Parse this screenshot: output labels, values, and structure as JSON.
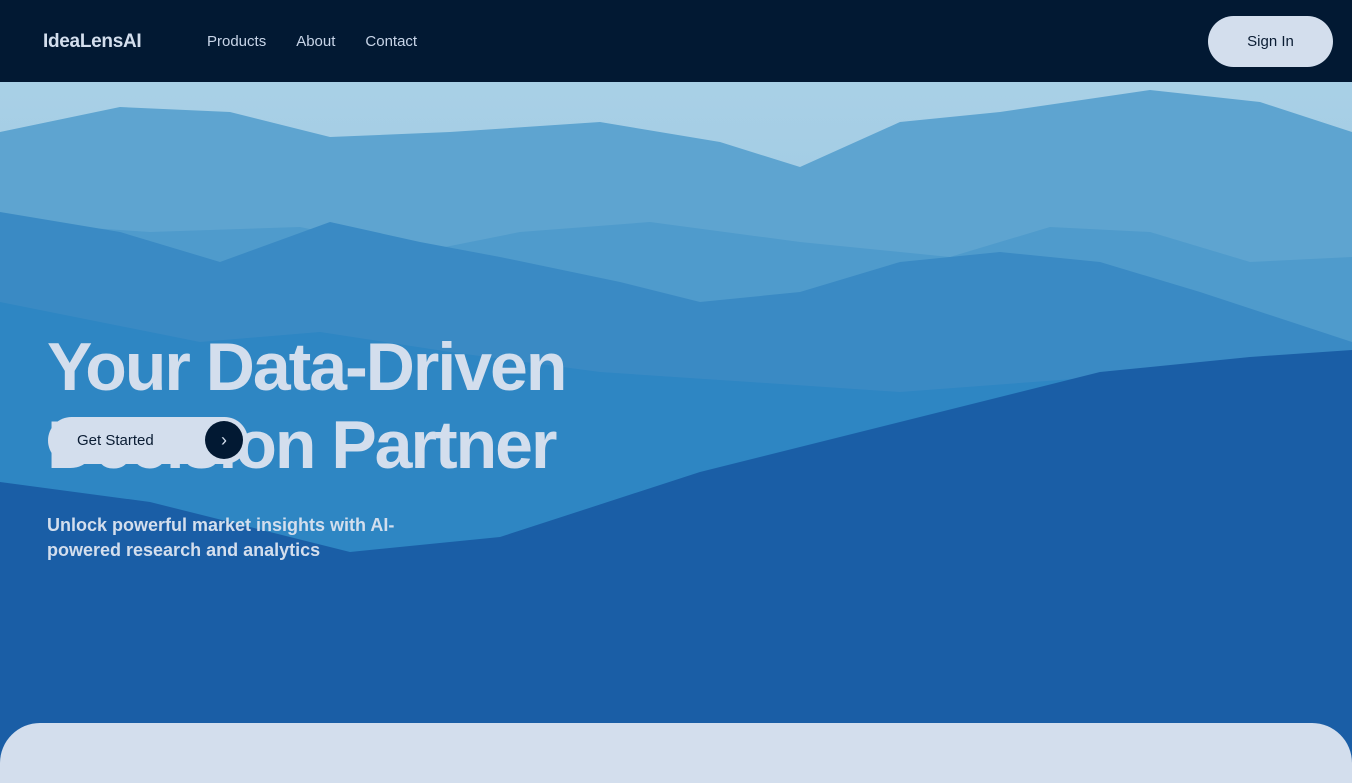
{
  "nav": {
    "logo": "IdeaLensAI",
    "links": [
      "Products",
      "About",
      "Contact"
    ],
    "sign_in": "Sign In"
  },
  "hero": {
    "title_line1": "Your Data-Driven",
    "title_line2": "Decision Partner",
    "cta_label": "Get Started",
    "subtitle": "Unlock powerful market insights with AI-powered research and analytics"
  },
  "colors": {
    "nav_bg": "#021933",
    "accent_light": "#d3deed"
  }
}
